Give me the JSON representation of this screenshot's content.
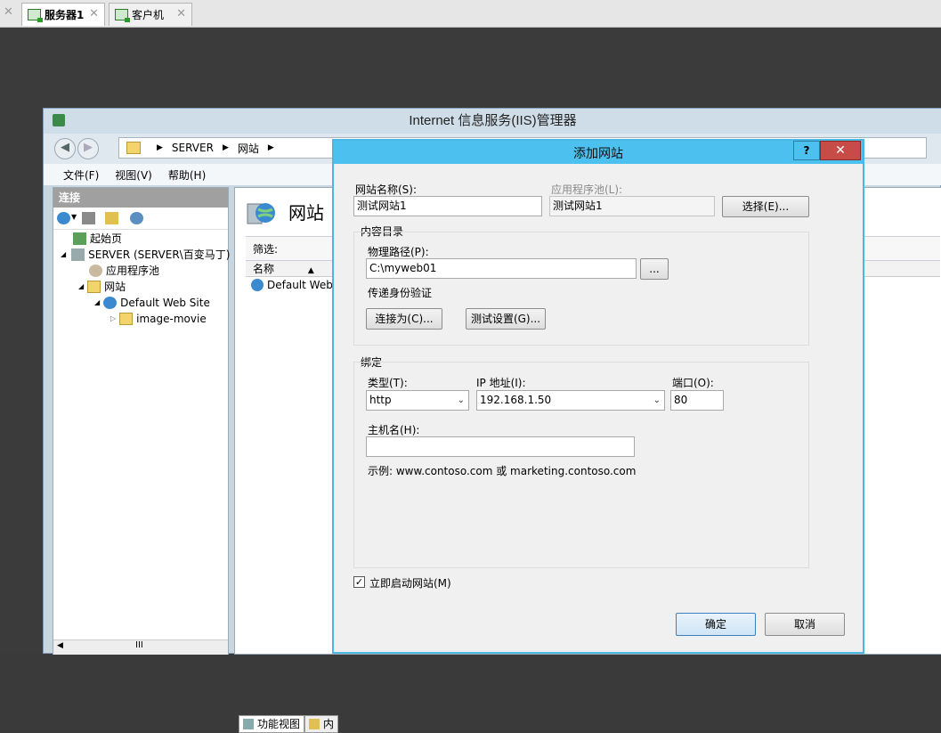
{
  "vm_tabs": [
    {
      "label": "服务器1",
      "active": true
    },
    {
      "label": "客户机",
      "active": false
    }
  ],
  "iis": {
    "title": "Internet 信息服务(IIS)管理器",
    "breadcrumb": [
      "SERVER",
      "网站"
    ],
    "menu": [
      "文件(F)",
      "视图(V)",
      "帮助(H)"
    ],
    "connections": {
      "header": "连接",
      "tree": [
        {
          "label": "起始页",
          "icon": "start-page-icon"
        },
        {
          "label": "SERVER (SERVER\\百变马丁)",
          "icon": "server-icon"
        },
        {
          "label": "应用程序池",
          "icon": "app-pool-icon"
        },
        {
          "label": "网站",
          "icon": "sites-folder-icon"
        },
        {
          "label": "Default Web Site",
          "icon": "globe-icon"
        },
        {
          "label": "image-movie",
          "icon": "folder-icon"
        }
      ],
      "scroll_glyph": "III"
    },
    "main": {
      "title": "网站",
      "filter_label": "筛选:",
      "column_name": "名称",
      "rows": [
        "Default Web"
      ],
      "bottom_tabs": [
        "功能视图",
        "内"
      ]
    }
  },
  "dialog": {
    "title": "添加网站",
    "help": "?",
    "close": "✕",
    "site_name_label": "网站名称(S):",
    "site_name_value": "测试网站1",
    "app_pool_label": "应用程序池(L):",
    "app_pool_value": "测试网站1",
    "select_button": "选择(E)...",
    "content_dir_label": "内容目录",
    "physical_path_label": "物理路径(P):",
    "physical_path_value": "C:\\myweb01",
    "browse_button": "...",
    "passthrough_label": "传递身份验证",
    "connect_as_button": "连接为(C)...",
    "test_settings_button": "测试设置(G)...",
    "binding_label": "绑定",
    "type_label": "类型(T):",
    "type_value": "http",
    "ip_label": "IP 地址(I):",
    "ip_value": "192.168.1.50",
    "port_label": "端口(O):",
    "port_value": "80",
    "hostname_label": "主机名(H):",
    "hostname_value": "",
    "example_text": "示例: www.contoso.com 或 marketing.contoso.com",
    "start_now_label": "立即启动网站(M)",
    "start_now_checked": true,
    "ok_button": "确定",
    "cancel_button": "取消"
  },
  "colors": {
    "dialog_title": "#4cc0ee",
    "close_button": "#c74b46",
    "host_background": "#3b3b3b"
  }
}
